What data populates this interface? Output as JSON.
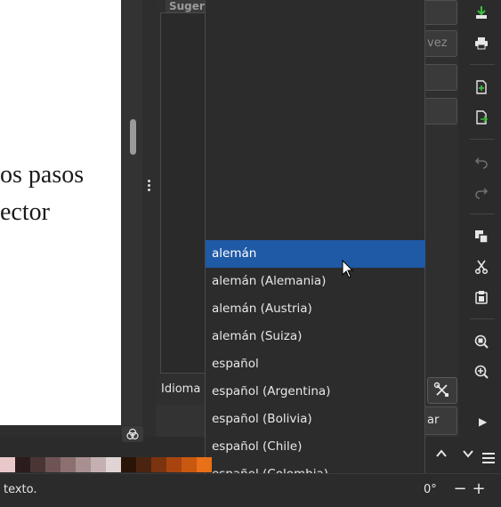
{
  "document": {
    "lines": [
      "os pasos",
      "ector"
    ]
  },
  "spelling": {
    "suggestions_label": "Sugere",
    "language_label": "Idioma",
    "button_vez": "vez",
    "button_ar": "ar"
  },
  "language_dropdown": {
    "selected": "alemán",
    "options": [
      "alemán",
      "alemán (Alemania)",
      "alemán (Austria)",
      "alemán (Suiza)",
      "español",
      "español (Argentina)",
      "español (Bolivia)",
      "español (Chile)",
      "español (Colombia)"
    ]
  },
  "statusbar": {
    "text": "texto.",
    "rotation": "0°",
    "zoom_out": "−",
    "zoom_in": "+"
  },
  "toolbar_icons": [
    "download-icon",
    "print-icon",
    "new-document-icon",
    "export-icon",
    "undo-icon",
    "redo-icon",
    "copy-icon",
    "cut-icon",
    "paste-icon",
    "zoom-fit-icon",
    "zoom-in-icon"
  ],
  "palette": [
    "#e8c8c8",
    "#2a1c1c",
    "#4a3434",
    "#6e5454",
    "#8c7070",
    "#a89090",
    "#c4b0b0",
    "#e0d4d4",
    "#2a1408",
    "#4a2410",
    "#7a3410",
    "#a84410",
    "#c85810",
    "#e87018"
  ],
  "colors": {
    "accent": "#1f5aa6",
    "background": "#2b2b2b"
  }
}
